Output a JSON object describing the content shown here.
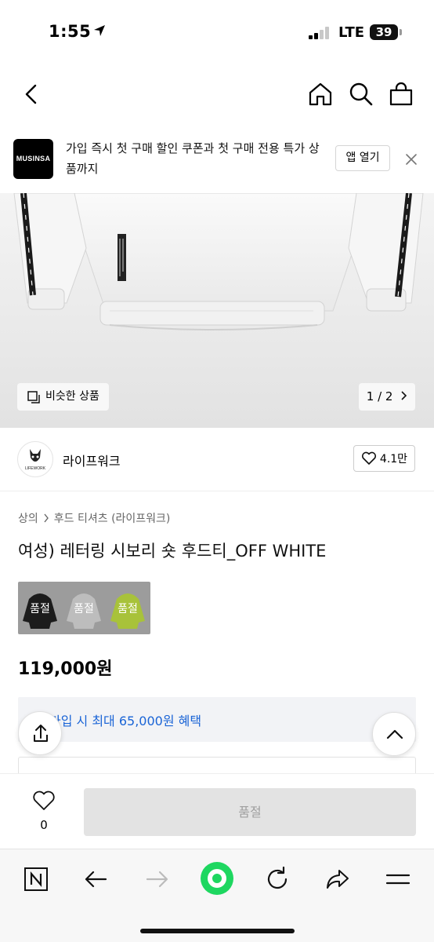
{
  "status": {
    "time": "1:55",
    "network": "LTE",
    "battery": "39"
  },
  "nav": {
    "icons": [
      "back-icon",
      "home-icon",
      "search-icon",
      "shopping-bag-icon"
    ]
  },
  "banner": {
    "logo": "MUSINSA",
    "text": "가입 즉시 첫 구매 할인 쿠폰과 첫 구매 전용 특가 상품까지",
    "open_label": "앱 열기"
  },
  "hero": {
    "similar_label": "비슷한 상품",
    "pager": "1 / 2"
  },
  "brand": {
    "name": "라이프워크",
    "likes": "4.1만",
    "avatar_text": "LIFEWORK"
  },
  "breadcrumb": [
    "상의",
    "후드 티셔츠 (라이프워크)"
  ],
  "product": {
    "title": "여성) 레터링 시보리 숏 후드티_OFF WHITE",
    "price": "119,000원",
    "variants": [
      {
        "label": "품절",
        "color": "#1c1c1c"
      },
      {
        "label": "품절",
        "color": "#b9b9b9"
      },
      {
        "label": "품절",
        "color": "#a8c23a"
      }
    ]
  },
  "promo": {
    "text": "가입 시 최대 65,000원 혜택"
  },
  "buybar": {
    "wish_count": "0",
    "buy_label": "품절"
  },
  "colors": {
    "accent": "#1a64d6",
    "browser_green": "#1ed760"
  }
}
